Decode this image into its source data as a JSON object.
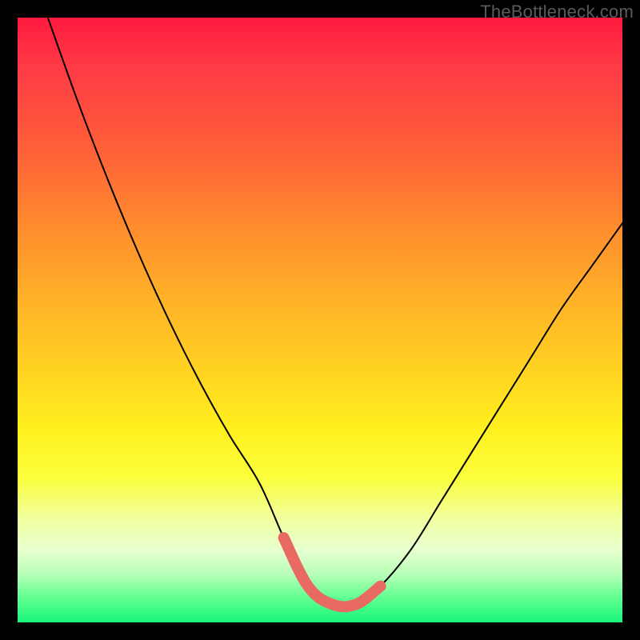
{
  "watermark": "TheBottleneck.com",
  "chart_data": {
    "type": "line",
    "title": "",
    "xlabel": "",
    "ylabel": "",
    "xlim": [
      0,
      100
    ],
    "ylim": [
      0,
      100
    ],
    "series": [
      {
        "name": "bottleneck-curve",
        "x": [
          5,
          10,
          15,
          20,
          25,
          30,
          35,
          40,
          44,
          48,
          52,
          56,
          60,
          65,
          70,
          75,
          80,
          85,
          90,
          95,
          100
        ],
        "values": [
          100,
          86,
          73,
          61,
          50,
          40,
          31,
          23,
          14,
          6,
          3,
          3,
          6,
          12,
          20,
          28,
          36,
          44,
          52,
          59,
          66
        ]
      }
    ],
    "annotations": [
      {
        "name": "valley-highlight",
        "type": "segment",
        "color": "#e86a62",
        "x": [
          44,
          48,
          52,
          56,
          60
        ],
        "values": [
          14,
          6,
          3,
          3,
          6
        ]
      }
    ]
  }
}
